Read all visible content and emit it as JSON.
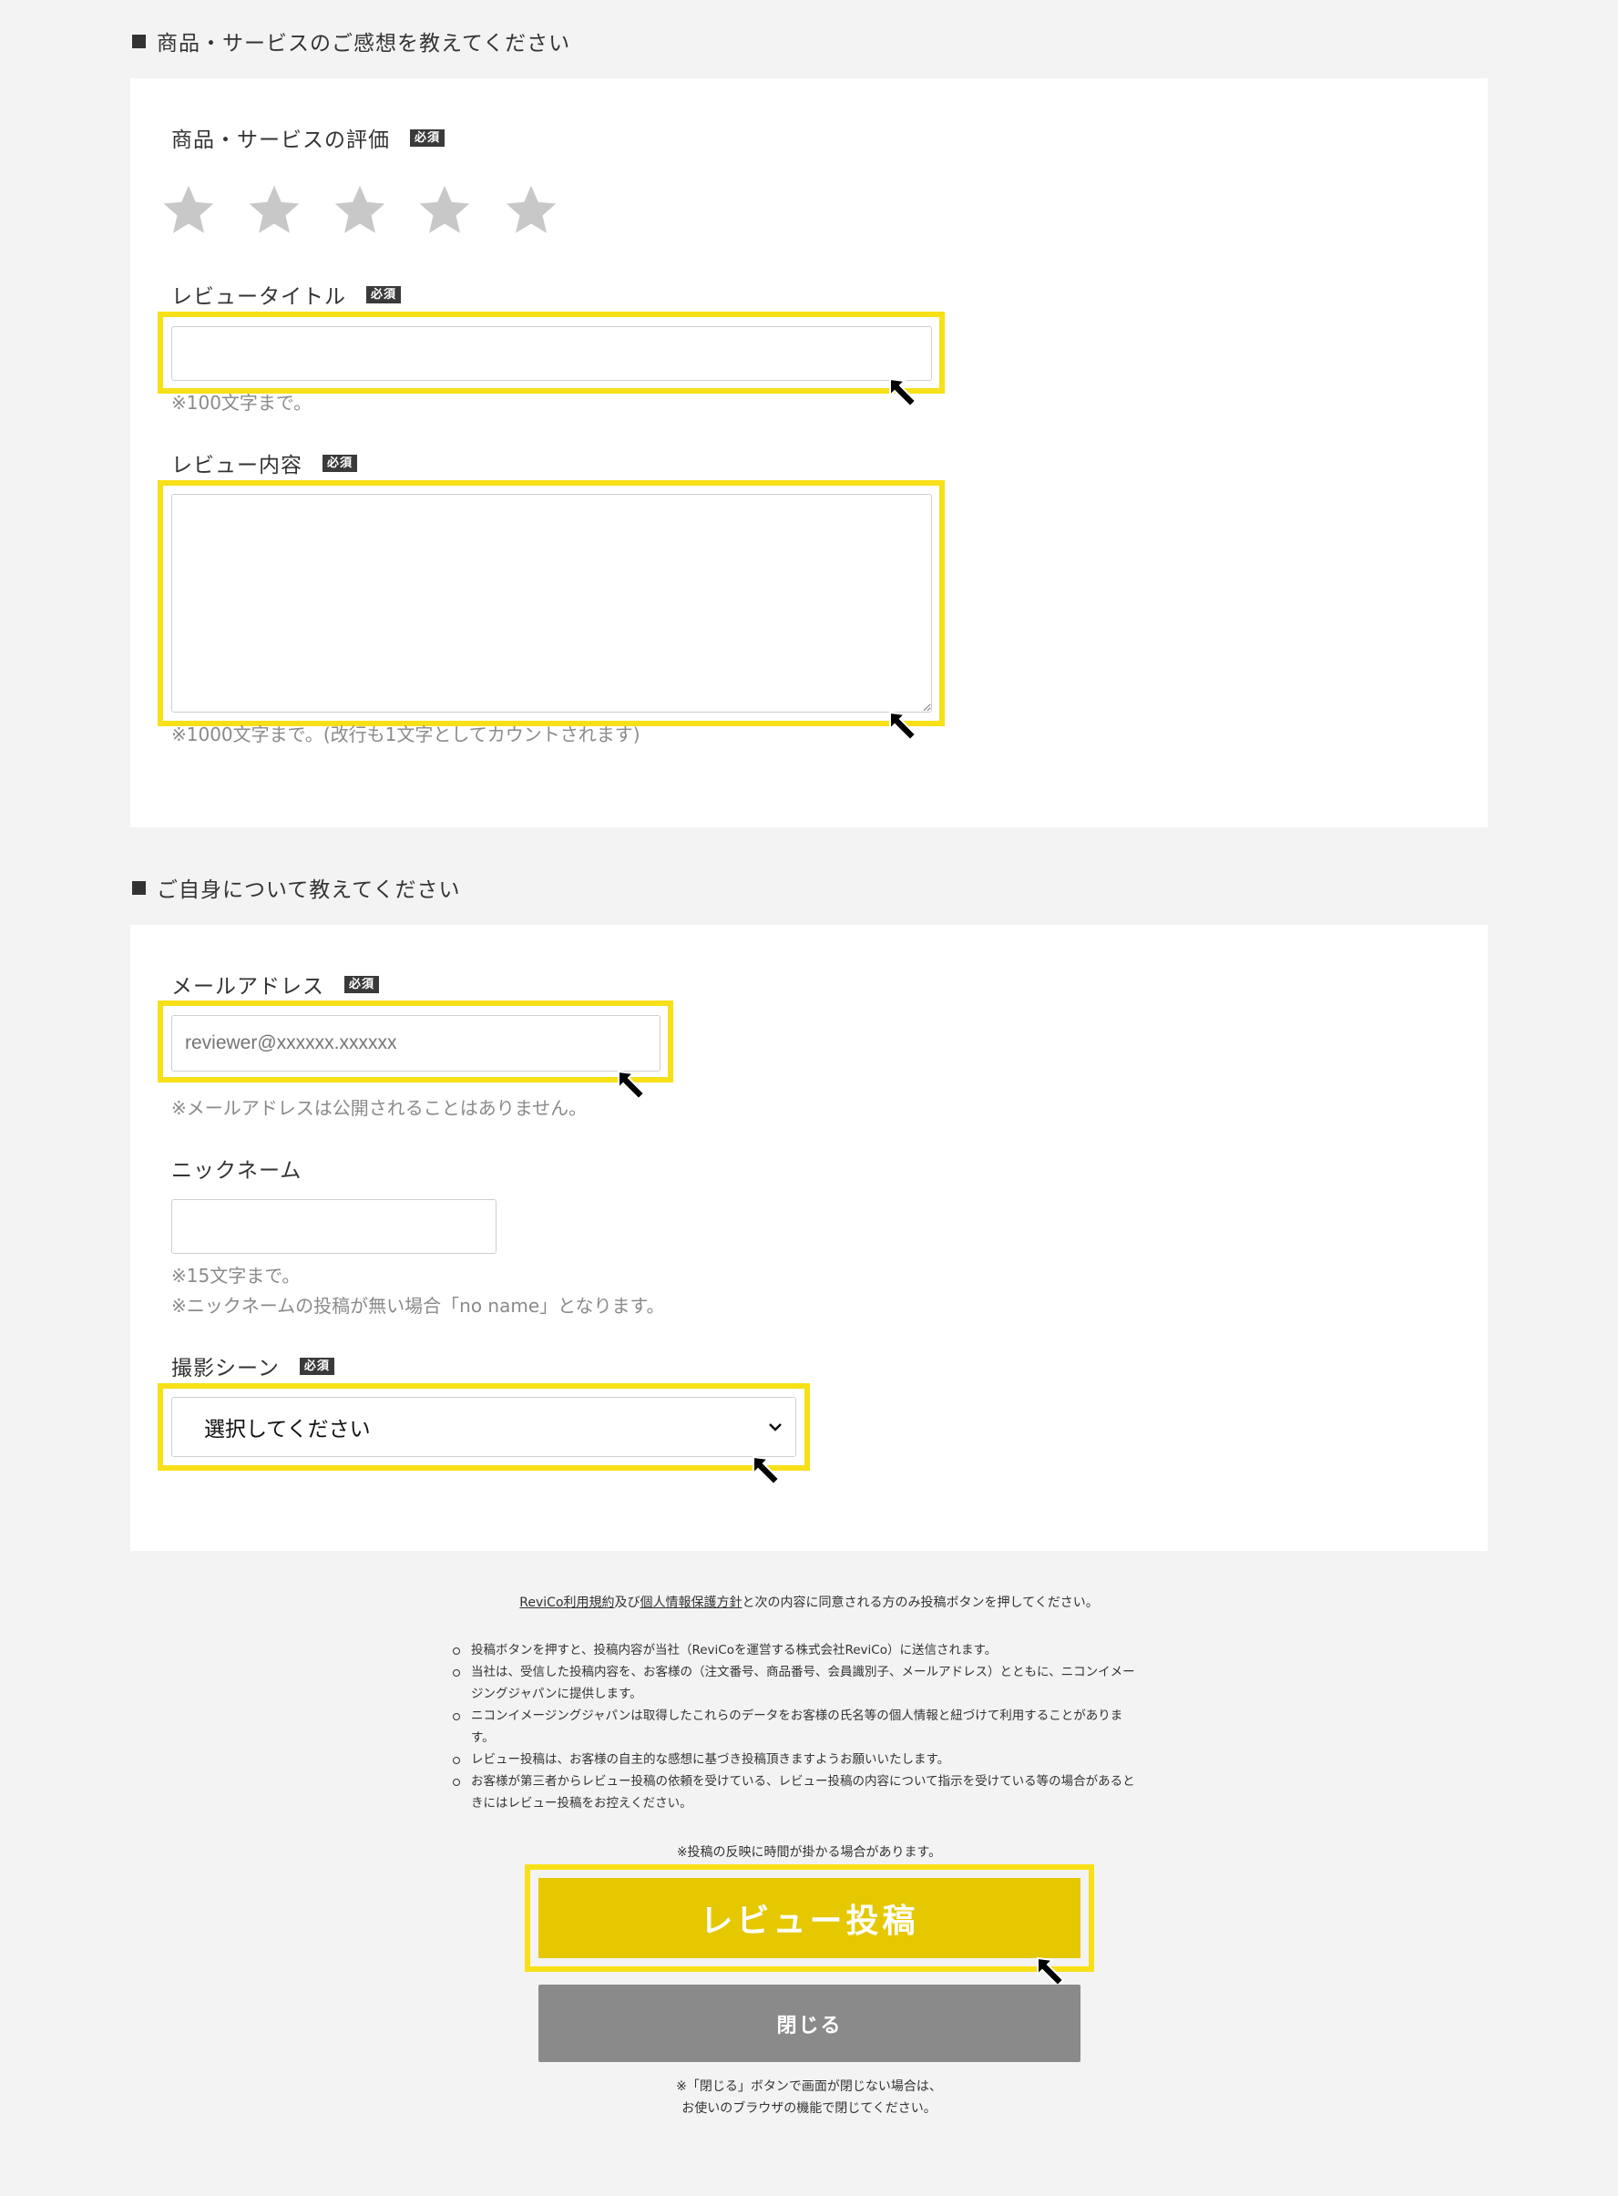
{
  "section1": {
    "heading": "商品・サービスのご感想を教えてください",
    "rating": {
      "label": "商品・サービスの評価",
      "required": "必須",
      "value": 0,
      "max": 5
    },
    "title_field": {
      "label": "レビュータイトル",
      "required": "必須",
      "value": "",
      "hint": "※100文字まで。"
    },
    "content_field": {
      "label": "レビュー内容",
      "required": "必須",
      "value": "",
      "hint": "※1000文字まで。(改行も1文字としてカウントされます)"
    }
  },
  "section2": {
    "heading": "ご自身について教えてください",
    "email_field": {
      "label": "メールアドレス",
      "required": "必須",
      "placeholder": "reviewer@xxxxxx.xxxxxx",
      "hint": "※メールアドレスは公開されることはありません。"
    },
    "nickname_field": {
      "label": "ニックネーム",
      "value": "",
      "hint1": "※15文字まで。",
      "hint2": "※ニックネームの投稿が無い場合「no name」となります。"
    },
    "scene_field": {
      "label": "撮影シーン",
      "required": "必須",
      "selected": "選択してください"
    }
  },
  "terms": {
    "link1": "ReviCo利用規約",
    "and": "及び",
    "link2": "個人情報保護方針",
    "rest": "と次の内容に同意される方のみ投稿ボタンを押してください。",
    "bullets": [
      "投稿ボタンを押すと、投稿内容が当社（ReviCoを運営する株式会社ReviCo）に送信されます。",
      "当社は、受信した投稿内容を、お客様の（注文番号、商品番号、会員識別子、メールアドレス）とともに、ニコンイメージングジャパンに提供します。",
      "ニコンイメージングジャパンは取得したこれらのデータをお客様の氏名等の個人情報と紐づけて利用することがあります。",
      "レビュー投稿は、お客様の自主的な感想に基づき投稿頂きますようお願いいたします。",
      "お客様が第三者からレビュー投稿の依頼を受けている、レビュー投稿の内容について指示を受けている等の場合があるときにはレビュー投稿をお控えください。"
    ],
    "note": "※投稿の反映に時間が掛かる場合があります。"
  },
  "buttons": {
    "submit": "レビュー投稿",
    "close": "閉じる"
  },
  "footer_note": {
    "line1": "※「閉じる」ボタンで画面が閉じない場合は、",
    "line2": "お使いのブラウザの機能で閉じてください。"
  },
  "colors": {
    "highlight": "#f7e018",
    "submit_bg": "#e5c800",
    "close_bg": "#8a8a8a",
    "star_empty": "#c8c8c8"
  }
}
